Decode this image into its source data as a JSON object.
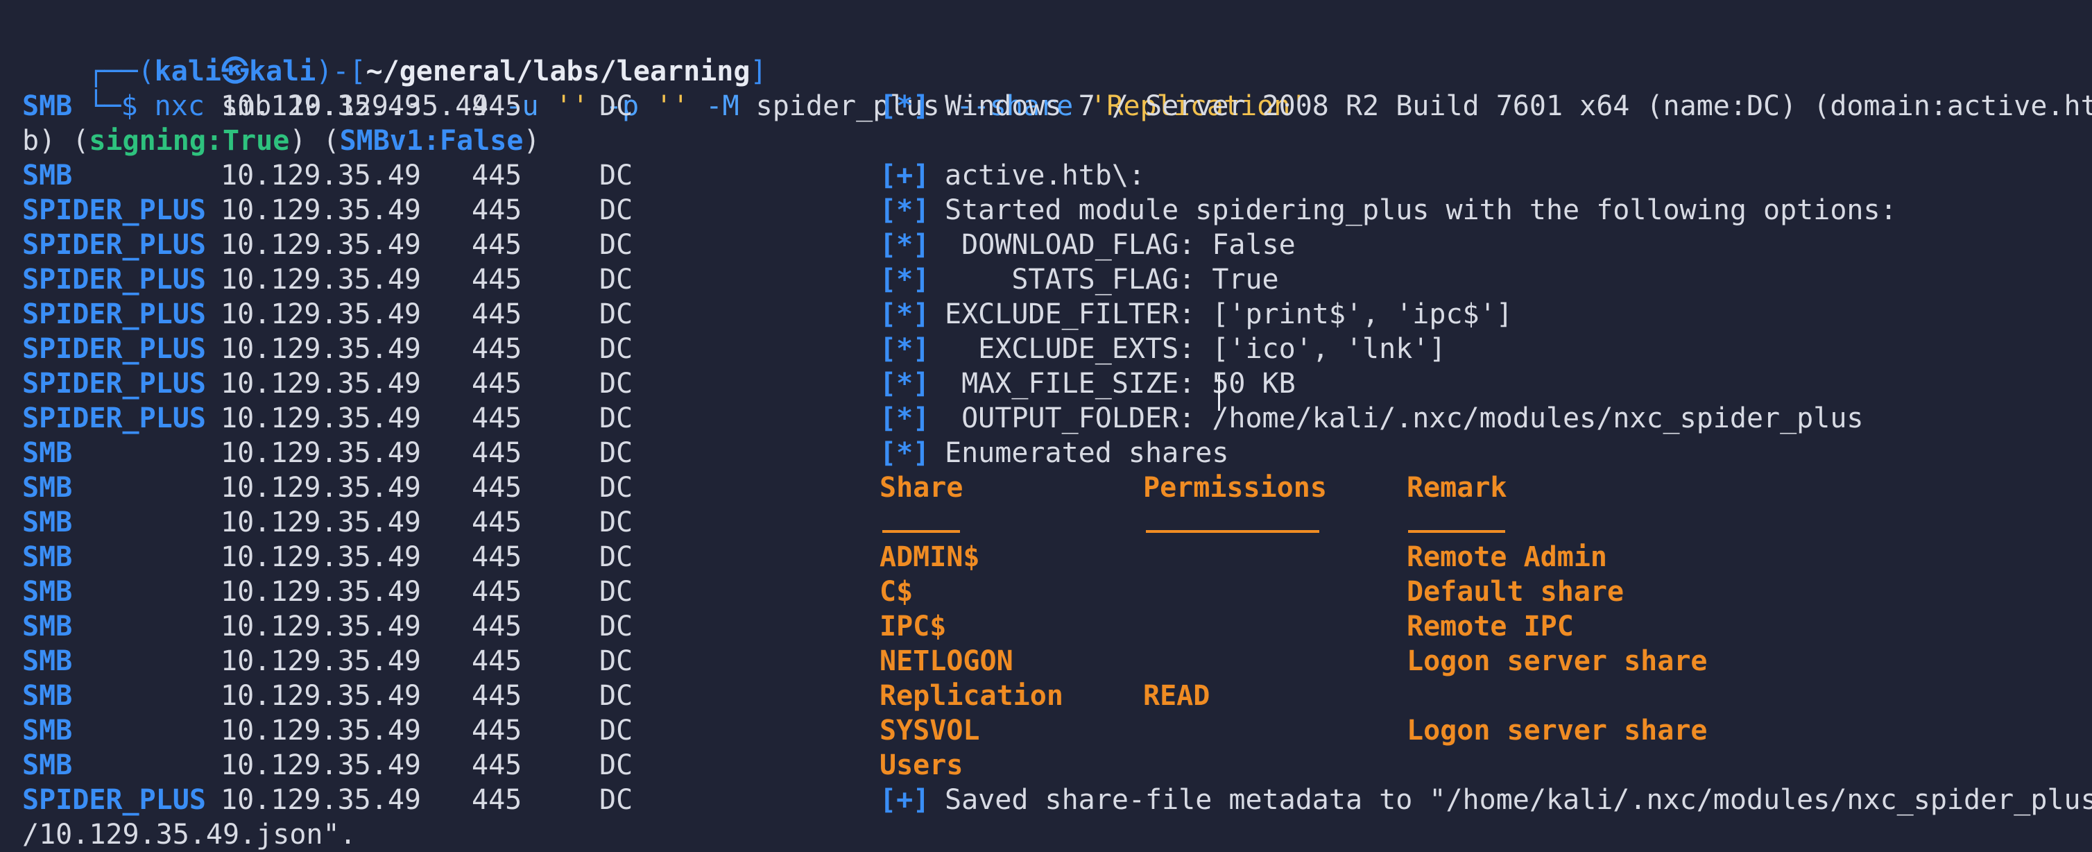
{
  "prompt": {
    "user": "kali",
    "host": "kali",
    "path": "~/general/labs/learning",
    "command": "nxc",
    "args_prefix": " smb 10.129.35.49 ",
    "flag_u": "-u",
    "str_u": " '' ",
    "flag_p": "-p",
    "str_p": " '' ",
    "flag_m": "-M",
    "module": " spider_plus ",
    "flag_share": "--share",
    "share_value": " 'Replication'"
  },
  "lines": [
    {
      "proto": "SMB",
      "ip": "10.129.35.49",
      "port": "445",
      "host": "DC",
      "tag": "[*]",
      "msg": "Windows 7 / Server 2008 R2 Build 7601 x64 (name:DC) (domain:active.ht"
    },
    {
      "wrap": "b) (",
      "signing": "signing:True",
      "mid": ") (",
      "smbv1": "SMBv1:False",
      "end": ")"
    },
    {
      "proto": "SMB",
      "ip": "10.129.35.49",
      "port": "445",
      "host": "DC",
      "tag": "[+]",
      "msg": "active.htb\\:"
    },
    {
      "proto": "SPIDER_PLUS",
      "ip": "10.129.35.49",
      "port": "445",
      "host": "DC",
      "tag": "[*]",
      "msg": "Started module spidering_plus with the following options:"
    },
    {
      "proto": "SPIDER_PLUS",
      "ip": "10.129.35.49",
      "port": "445",
      "host": "DC",
      "tag": "[*]",
      "msg": " DOWNLOAD_FLAG: False"
    },
    {
      "proto": "SPIDER_PLUS",
      "ip": "10.129.35.49",
      "port": "445",
      "host": "DC",
      "tag": "[*]",
      "msg": "    STATS_FLAG: True"
    },
    {
      "proto": "SPIDER_PLUS",
      "ip": "10.129.35.49",
      "port": "445",
      "host": "DC",
      "tag": "[*]",
      "msg": "EXCLUDE_FILTER: ['print$', 'ipc$']"
    },
    {
      "proto": "SPIDER_PLUS",
      "ip": "10.129.35.49",
      "port": "445",
      "host": "DC",
      "tag": "[*]",
      "msg": "  EXCLUDE_EXTS: ['ico', 'lnk']"
    },
    {
      "proto": "SPIDER_PLUS",
      "ip": "10.129.35.49",
      "port": "445",
      "host": "DC",
      "tag": "[*]",
      "msg": " MAX_FILE_SIZE: 50 KB"
    },
    {
      "proto": "SPIDER_PLUS",
      "ip": "10.129.35.49",
      "port": "445",
      "host": "DC",
      "tag": "[*]",
      "msg": " OUTPUT_FOLDER: /home/kali/.nxc/modules/nxc_spider_plus"
    },
    {
      "proto": "SMB",
      "ip": "10.129.35.49",
      "port": "445",
      "host": "DC",
      "tag": "[*]",
      "msg": "Enumerated shares"
    }
  ],
  "share_table": {
    "headers": {
      "share": "Share",
      "perm": "Permissions",
      "remark": "Remark"
    },
    "rows": [
      {
        "share": "ADMIN$",
        "perm": "",
        "remark": "Remote Admin"
      },
      {
        "share": "C$",
        "perm": "",
        "remark": "Default share"
      },
      {
        "share": "IPC$",
        "perm": "",
        "remark": "Remote IPC"
      },
      {
        "share": "NETLOGON",
        "perm": "",
        "remark": "Logon server share"
      },
      {
        "share": "Replication",
        "perm": "READ",
        "remark": ""
      },
      {
        "share": "SYSVOL",
        "perm": "",
        "remark": "Logon server share"
      },
      {
        "share": "Users",
        "perm": "",
        "remark": ""
      }
    ],
    "proto": "SMB",
    "ip": "10.129.35.49",
    "port": "445",
    "host": "DC"
  },
  "final": {
    "proto": "SPIDER_PLUS",
    "ip": "10.129.35.49",
    "port": "445",
    "host": "DC",
    "tag": "[+]",
    "msg": "Saved share-file metadata to \"/home/kali/.nxc/modules/nxc_spider_plus",
    "wrap": "/10.129.35.49.json\"."
  },
  "colors": {
    "background": "#1f2335",
    "blue": "#3a8ef6",
    "green": "#2ec27e",
    "orange": "#f08c23",
    "text": "#dfe3ee"
  }
}
